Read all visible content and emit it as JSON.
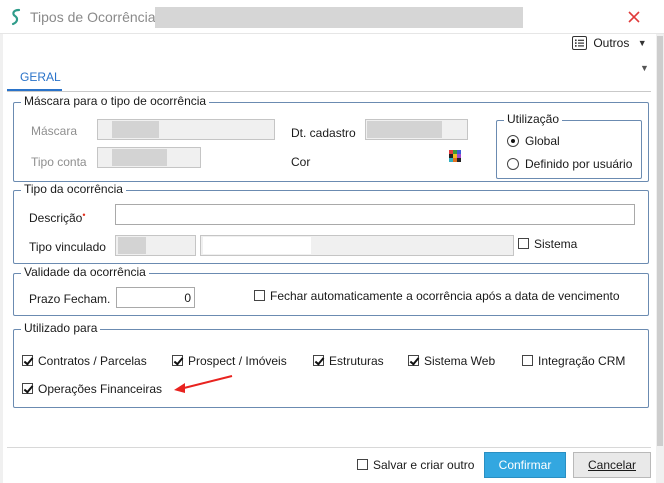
{
  "window": {
    "title": "Tipos de Ocorrência (",
    "icon": "sienge-logo-icon",
    "close_glyph": "✕",
    "accent": "#2a73c9"
  },
  "toolbar": {
    "outros_label": "Outros",
    "outros_caret": "▼",
    "secondary_caret": "▼"
  },
  "tabs": [
    {
      "label": "GERAL",
      "active": true
    }
  ],
  "mascara_group": {
    "legend": "Máscara para o tipo de ocorrência",
    "mascara_label": "Máscara",
    "tipo_conta_label": "Tipo conta",
    "dt_cadastro_label": "Dt. cadastro",
    "cor_label": "Cor",
    "utilizacao": {
      "legend": "Utilização",
      "options": [
        {
          "label": "Global",
          "selected": true
        },
        {
          "label": "Definido por usuário",
          "selected": false
        }
      ]
    }
  },
  "tipo_group": {
    "legend": "Tipo da ocorrência",
    "descricao_label": "Descrição",
    "required_marker": "•",
    "descricao_value": "",
    "tipo_vinculado_label": "Tipo vinculado",
    "sistema_label": "Sistema",
    "sistema_checked": false
  },
  "validade_group": {
    "legend": "Validade da ocorrência",
    "prazo_label": "Prazo Fecham.",
    "prazo_value": "0",
    "fechar_auto_label": "Fechar automaticamente a ocorrência após a data de vencimento",
    "fechar_auto_checked": false
  },
  "utilizado_group": {
    "legend": "Utilizado para",
    "items": [
      {
        "label": "Contratos / Parcelas",
        "checked": true
      },
      {
        "label": "Prospect / Imóveis",
        "checked": true
      },
      {
        "label": "Estruturas",
        "checked": true
      },
      {
        "label": "Sistema Web",
        "checked": true
      },
      {
        "label": "Integração CRM",
        "checked": false
      },
      {
        "label": "Operações Financeiras",
        "checked": true
      }
    ],
    "annotation_color": "#e8231f"
  },
  "footer": {
    "salvar_criar_label": "Salvar e criar outro",
    "salvar_criar_checked": false,
    "confirmar_label": "Confirmar",
    "cancelar_label": "Cancelar",
    "confirmar_color": "#33a7e0"
  }
}
